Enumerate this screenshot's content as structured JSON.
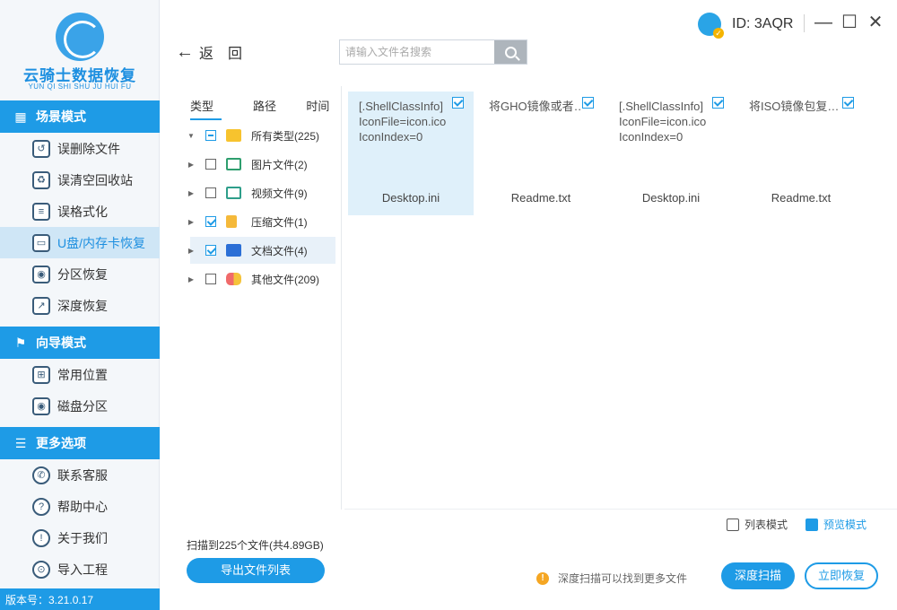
{
  "app": {
    "title": "云骑士数据恢复",
    "subtitle": "YUN QI SHI SHU JU HUI FU",
    "version": "版本号：3.21.0.17"
  },
  "user": {
    "id": "ID: 3AQR"
  },
  "window": {
    "minimize": "—",
    "maximize": "☐",
    "close": "✕"
  },
  "nav": {
    "back_label": "返回",
    "search_placeholder": "请输入文件名搜索"
  },
  "sidebar": {
    "sections": [
      {
        "title": "场景模式",
        "items": [
          "误删除文件",
          "误清空回收站",
          "误格式化",
          "U盘/内存卡恢复",
          "分区恢复",
          "深度恢复"
        ]
      },
      {
        "title": "向导模式",
        "items": [
          "常用位置",
          "磁盘分区"
        ]
      },
      {
        "title": "更多选项",
        "items": [
          "联系客服",
          "帮助中心",
          "关于我们",
          "导入工程"
        ]
      }
    ],
    "active_item": "U盘/内存卡恢复"
  },
  "category_panel": {
    "tabs": [
      "类型",
      "路径",
      "时间"
    ],
    "active_tab": "类型",
    "tree": [
      {
        "label": "所有类型(225)",
        "state": "partial",
        "expanded": true,
        "icon": "folder-icon"
      },
      {
        "label": "图片文件(2)",
        "state": "unchecked",
        "icon": "image-icon"
      },
      {
        "label": "视频文件(9)",
        "state": "unchecked",
        "icon": "video-icon"
      },
      {
        "label": "压缩文件(1)",
        "state": "checked",
        "icon": "archive-icon"
      },
      {
        "label": "文档文件(4)",
        "state": "checked",
        "icon": "document-icon",
        "selected": true
      },
      {
        "label": "其他文件(209)",
        "state": "unchecked",
        "icon": "other-icon"
      }
    ]
  },
  "files": [
    {
      "preview": "[.ShellClassInfo]\nIconFile=icon.ico\nIconIndex=0",
      "name": "Desktop.ini",
      "checked": true,
      "selected": true
    },
    {
      "preview": "将GHO镜像或者…",
      "name": "Readme.txt",
      "checked": true,
      "selected": false
    },
    {
      "preview": "[.ShellClassInfo]\nIconFile=icon.ico\nIconIndex=0",
      "name": "Desktop.ini",
      "checked": true,
      "selected": false
    },
    {
      "preview": "将ISO镜像包复…",
      "name": "Readme.txt",
      "checked": true,
      "selected": false
    }
  ],
  "view_modes": {
    "list": "列表模式",
    "preview": "预览模式",
    "active": "preview"
  },
  "footer": {
    "scan_info": "扫描到225个文件(共4.89GB)",
    "export_button": "导出文件列表",
    "tip": "深度扫描可以找到更多文件",
    "deep_scan_button": "深度扫描",
    "recover_button": "立即恢复"
  },
  "colors": {
    "accent": "#1e9be6",
    "active_nav_bg": "#cfe6f6",
    "sidebar_bg": "#f4f7fa",
    "warning": "#f5a623"
  }
}
